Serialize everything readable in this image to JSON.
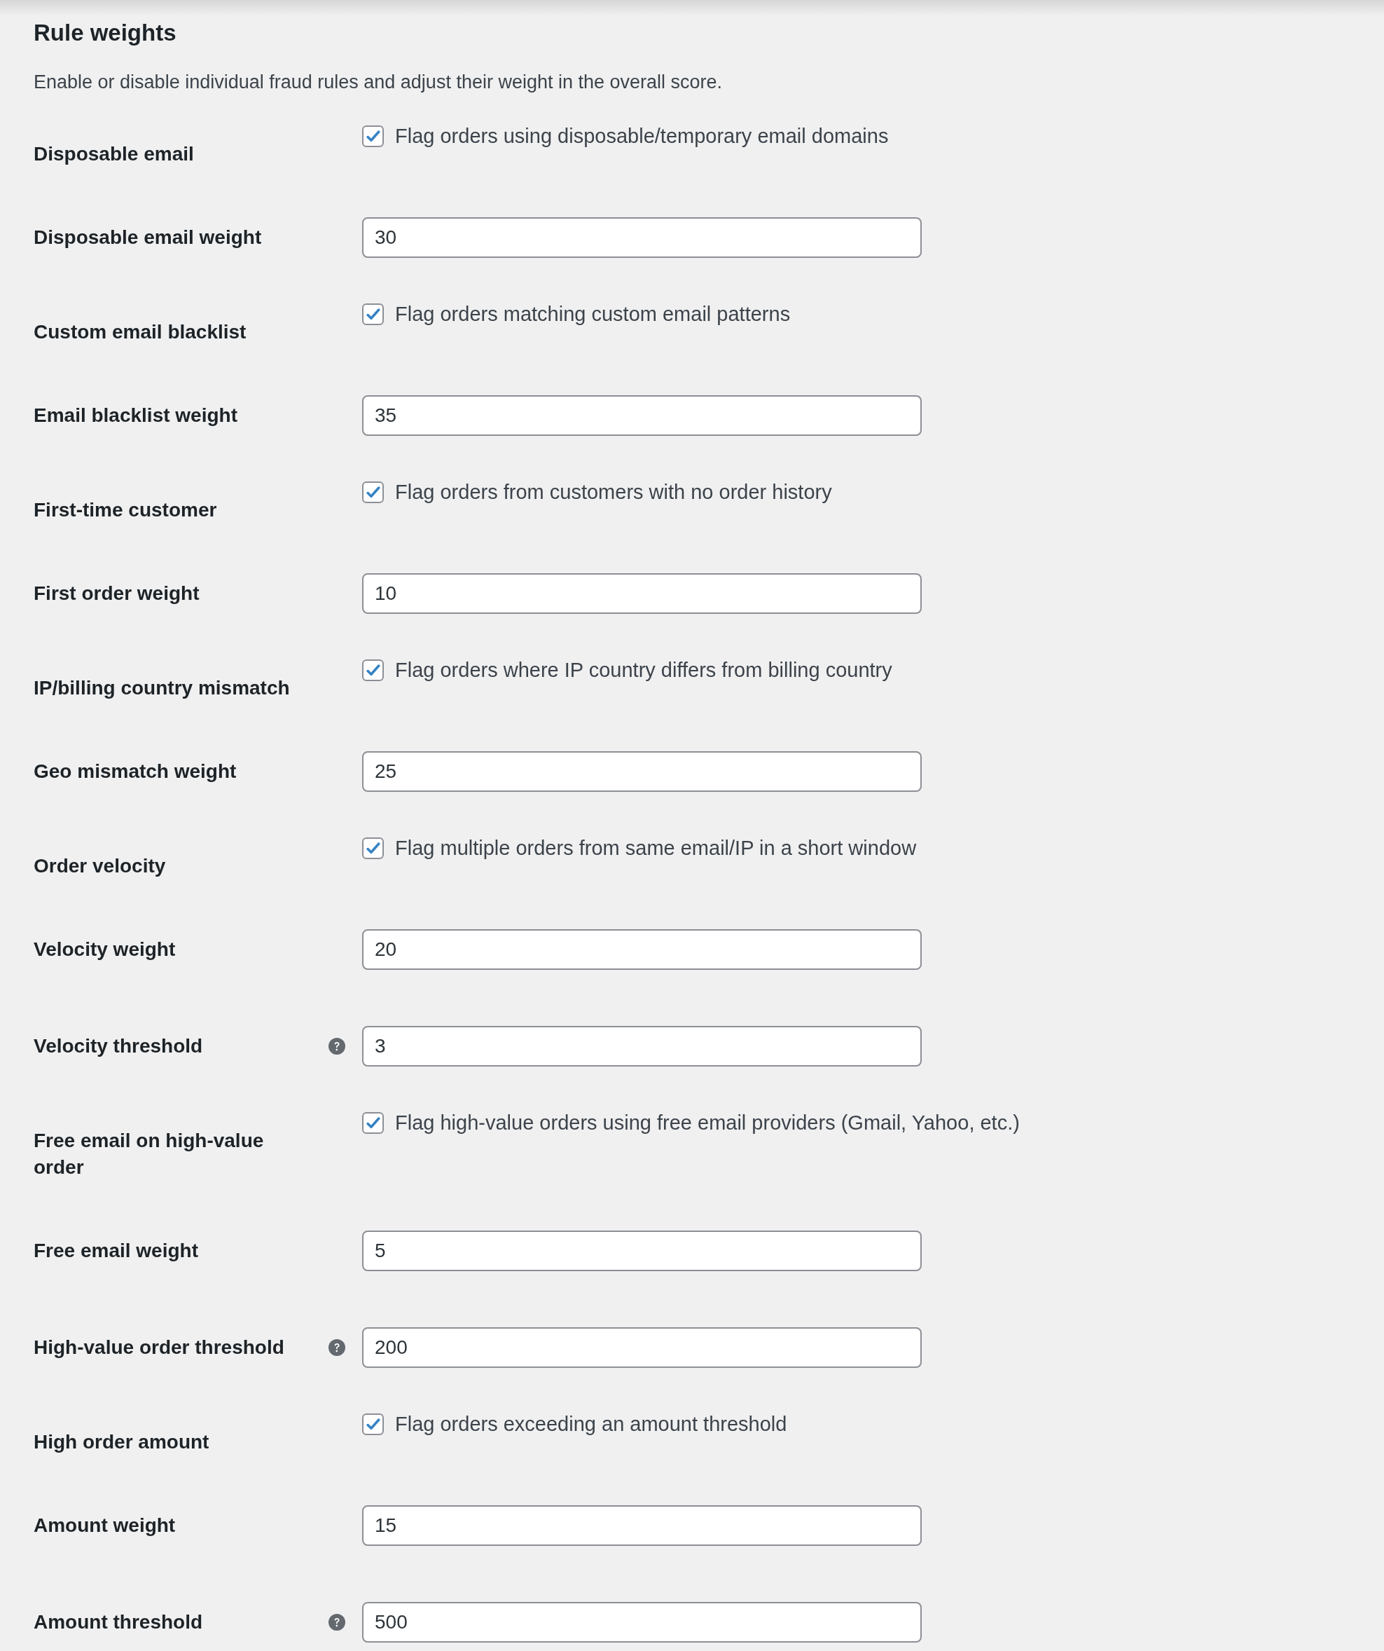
{
  "section": {
    "title": "Rule weights",
    "description": "Enable or disable individual fraud rules and adjust their weight in the overall score."
  },
  "fields": [
    {
      "kind": "checkbox",
      "label": "Disposable email",
      "text": "Flag orders using disposable/temporary email domains",
      "checked": true
    },
    {
      "kind": "number",
      "label": "Disposable email weight",
      "value": "30"
    },
    {
      "kind": "checkbox",
      "label": "Custom email blacklist",
      "text": "Flag orders matching custom email patterns",
      "checked": true
    },
    {
      "kind": "number",
      "label": "Email blacklist weight",
      "value": "35"
    },
    {
      "kind": "checkbox",
      "label": "First-time customer",
      "text": "Flag orders from customers with no order history",
      "checked": true
    },
    {
      "kind": "number",
      "label": "First order weight",
      "value": "10"
    },
    {
      "kind": "checkbox",
      "label": "IP/billing country mismatch",
      "text": "Flag orders where IP country differs from billing country",
      "checked": true
    },
    {
      "kind": "number",
      "label": "Geo mismatch weight",
      "value": "25"
    },
    {
      "kind": "checkbox",
      "label": "Order velocity",
      "text": "Flag multiple orders from same email/IP in a short window",
      "checked": true
    },
    {
      "kind": "number",
      "label": "Velocity weight",
      "value": "20"
    },
    {
      "kind": "number",
      "label": "Velocity threshold",
      "value": "3",
      "help": true
    },
    {
      "kind": "checkbox",
      "label": "Free email on high-value order",
      "text": "Flag high-value orders using free email providers (Gmail, Yahoo, etc.)",
      "checked": true
    },
    {
      "kind": "number",
      "label": "Free email weight",
      "value": "5"
    },
    {
      "kind": "number",
      "label": "High-value order threshold",
      "value": "200",
      "help": true
    },
    {
      "kind": "checkbox",
      "label": "High order amount",
      "text": "Flag orders exceeding an amount threshold",
      "checked": true
    },
    {
      "kind": "number",
      "label": "Amount weight",
      "value": "15"
    },
    {
      "kind": "number",
      "label": "Amount threshold",
      "value": "500",
      "help": true
    }
  ]
}
